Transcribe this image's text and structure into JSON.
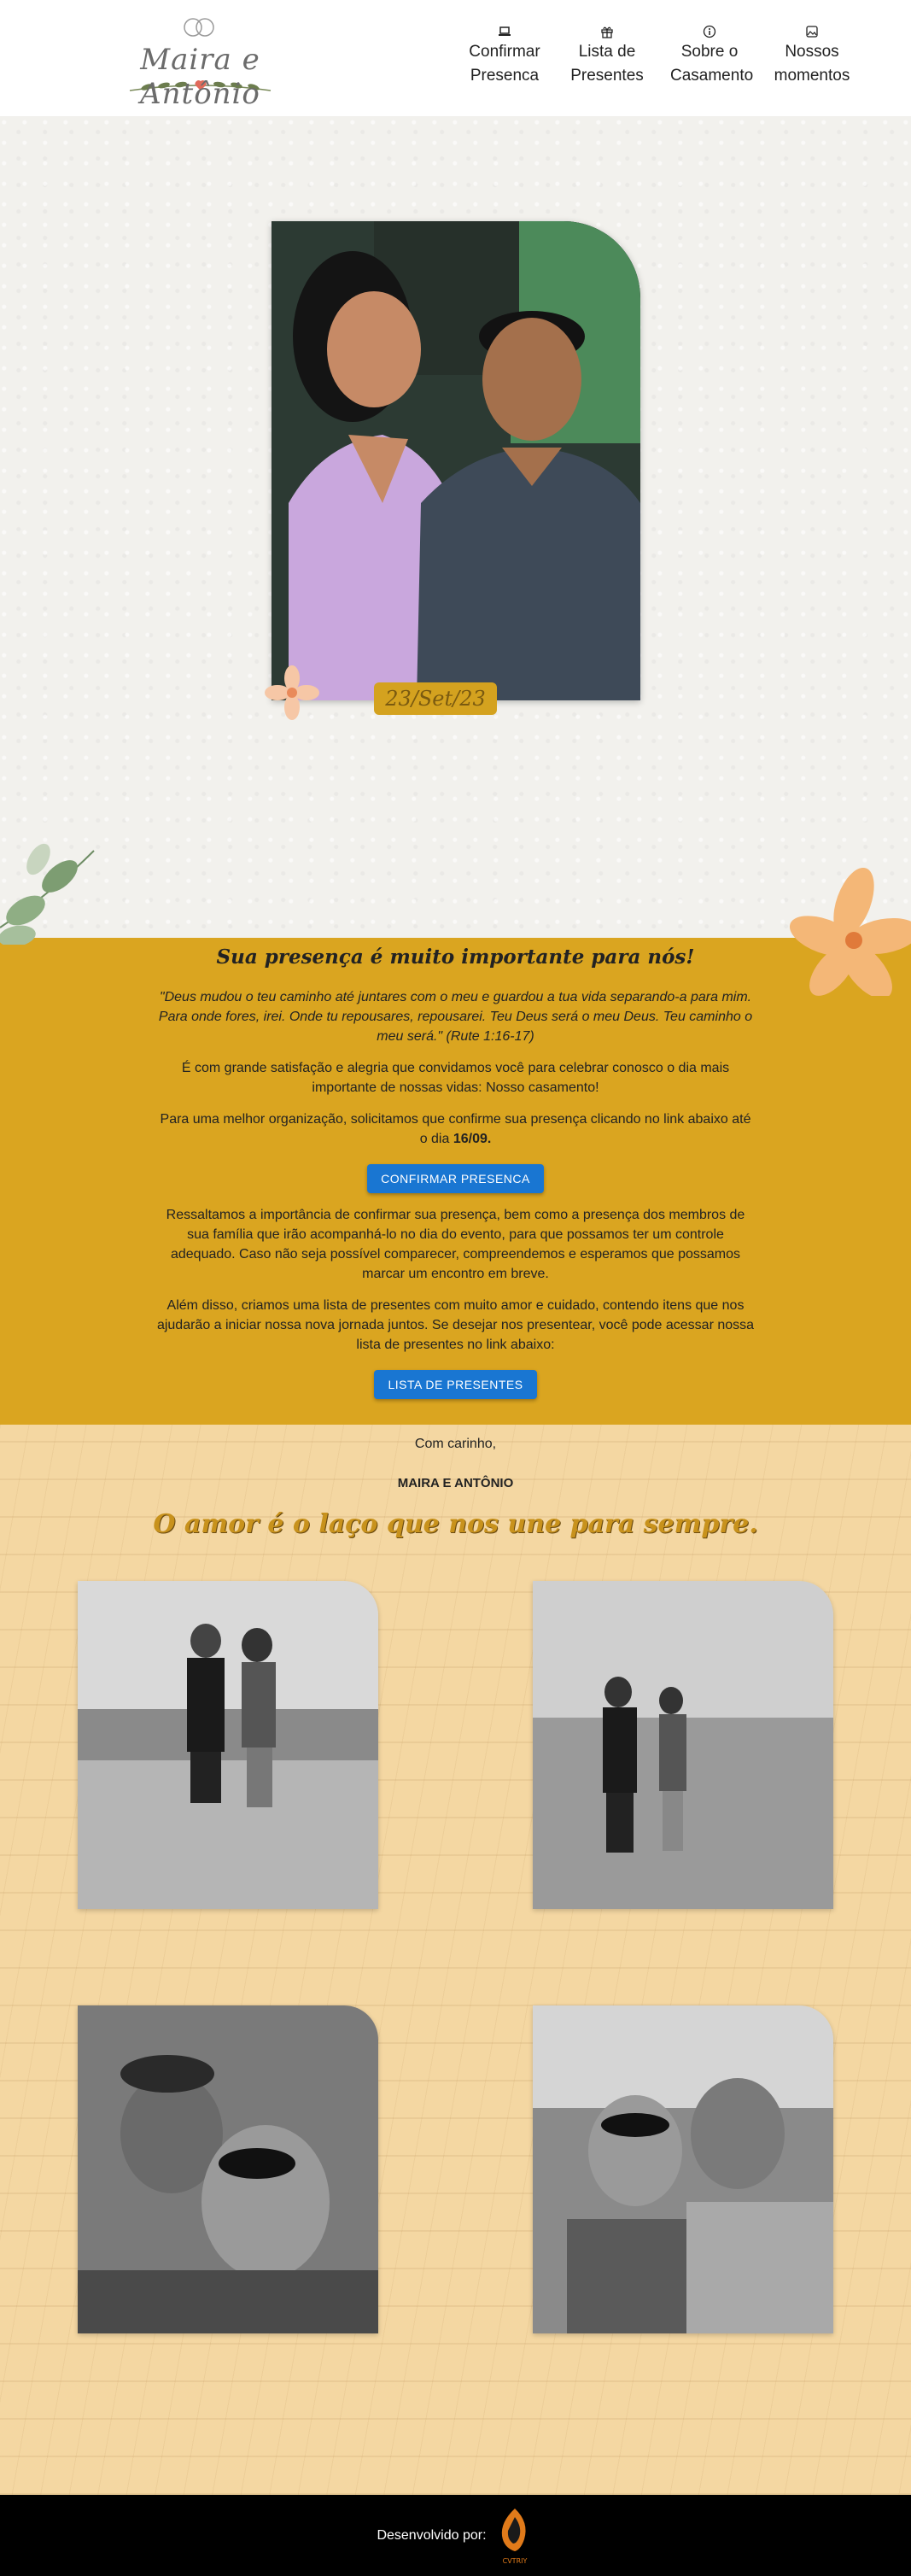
{
  "header": {
    "logo_text": "Maira e Antônio",
    "nav": [
      {
        "label_line1": "Confirmar",
        "label_line2": "Presenca",
        "icon": "laptop-icon"
      },
      {
        "label_line1": "Lista de",
        "label_line2": "Presentes",
        "icon": "gift-icon"
      },
      {
        "label_line1": "Sobre o",
        "label_line2": "Casamento",
        "icon": "info-icon"
      },
      {
        "label_line1": "Nossos",
        "label_line2": "momentos",
        "icon": "image-icon"
      }
    ]
  },
  "hero": {
    "date_badge": "23/Set/23"
  },
  "invite": {
    "title": "Sua presença é muito importante para nós!",
    "quote": "\"Deus mudou o teu caminho até juntares com o meu e guardou a tua vida separando-a para mim. Para onde fores, irei. Onde tu repousares, repousarei. Teu Deus será o meu Deus. Teu caminho o meu será.\" (Rute 1:16-17)",
    "p1": "É com grande satisfação e alegria que convidamos você para celebrar conosco o dia mais importante de nossas vidas: Nosso casamento!",
    "p2_text": "Para uma melhor organização, solicitamos que confirme sua presença clicando no link abaixo até o dia ",
    "p2_date": "16/09.",
    "btn_confirm": "CONFIRMAR PRESENCA",
    "p3": "Ressaltamos a importância de confirmar sua presença, bem como a presença dos membros de sua família que irão acompanhá-lo no dia do evento, para que possamos ter um controle adequado. Caso não seja possível comparecer, compreendemos e esperamos que possamos marcar um encontro em breve.",
    "p4": "Além disso, criamos uma lista de presentes com muito amor e cuidado, contendo itens que nos ajudarão a iniciar nossa nova jornada juntos. Se desejar nos presentear, você pode acessar nossa lista de presentes no link abaixo:",
    "btn_gifts": "LISTA DE PRESENTES"
  },
  "closing": {
    "carinho": "Com carinho,",
    "signature": "MAIRA E ANTÔNIO",
    "love_title": "O amor é o laço que nos une para sempre."
  },
  "footer": {
    "dev_label": "Desenvolvido por:",
    "dev_logo_text": "CVTRIY"
  }
}
